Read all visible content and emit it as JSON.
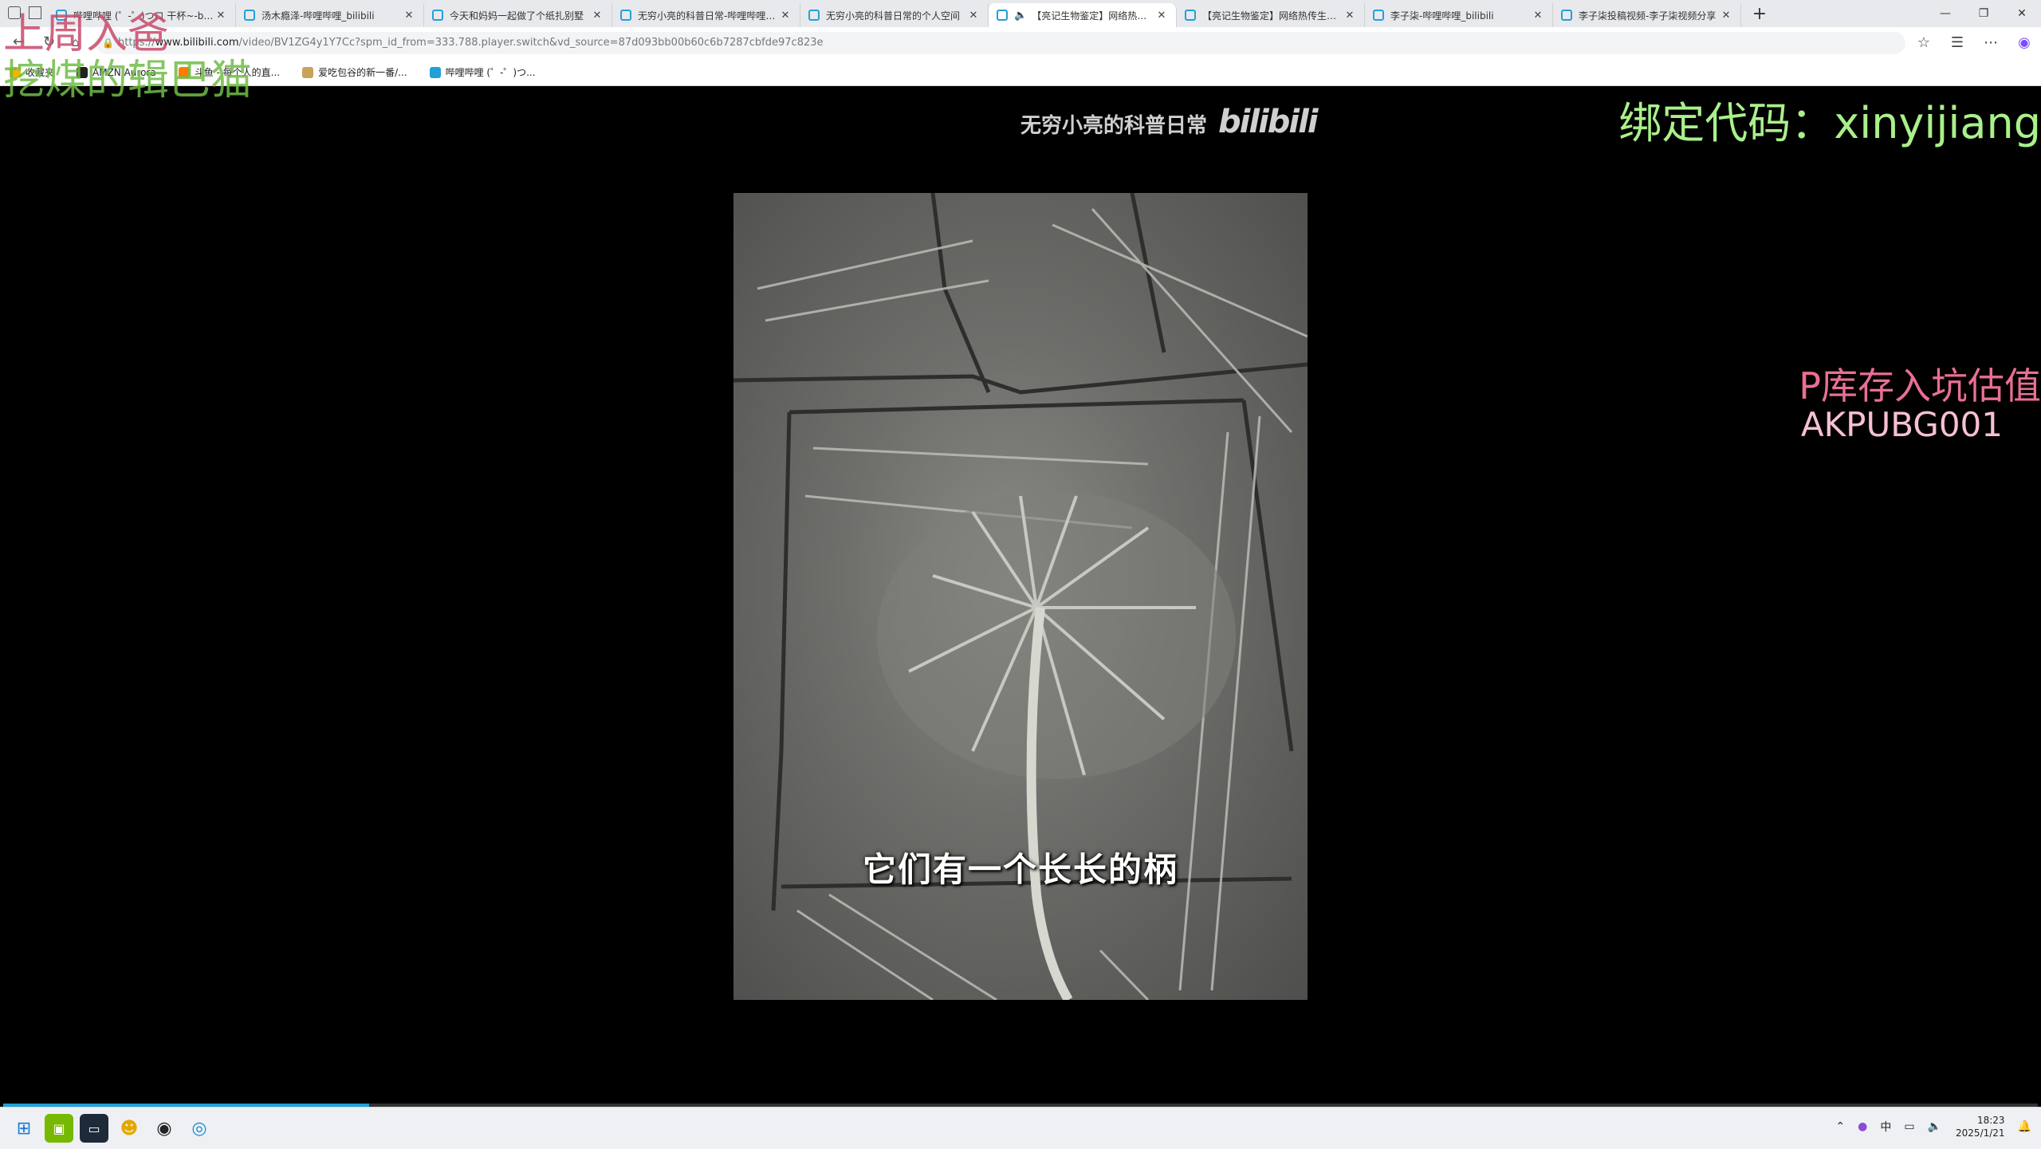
{
  "browser": {
    "tabs": [
      {
        "label": "哔哩哔哩 (゜-゜)つロ 干杯~-bilibili",
        "active": false
      },
      {
        "label": "汤木瘾泽-哔哩哔哩_bilibili",
        "active": false
      },
      {
        "label": "今天和妈妈一起做了个纸扎别墅",
        "active": false
      },
      {
        "label": "无穷小亮的科普日常-哔哩哔哩_bilibili",
        "active": false
      },
      {
        "label": "无穷小亮的科普日常的个人空间",
        "active": false
      },
      {
        "label": "【亮记生物鉴定】网络热传生物鉴定",
        "active": true
      },
      {
        "label": "【亮记生物鉴定】网络热传生物鉴定",
        "active": false
      },
      {
        "label": "李子柒-哔哩哔哩_bilibili",
        "active": false
      },
      {
        "label": "李子柒投稿视频-李子柒视频分享",
        "active": false
      }
    ],
    "url_prefix": "https://",
    "url_host": "www.bilibili.com",
    "url_path": "/video/BV1ZG4y1Y7Cc?spm_id_from=333.788.player.switch&vd_source=87d093bb00b60c6b7287cbfde97c823e",
    "bookmarks": [
      {
        "label": "收藏夹",
        "color": "#f5b400"
      },
      {
        "label": "AMZN Aurora",
        "color": "#222222"
      },
      {
        "label": "斗鱼 - 每个人的直...",
        "color": "#ff7a00"
      },
      {
        "label": "爱吃包谷的新一番/...",
        "color": "#c9a35a"
      },
      {
        "label": "哔哩哔哩 (゜-゜)つ...",
        "color": "#23a0d8"
      }
    ]
  },
  "video": {
    "watermark_text": "无穷小亮的科普日常",
    "watermark_logo": "bilibili",
    "subtitle": "它们有一个长长的柄",
    "progress_fraction": 0.18
  },
  "overlays": {
    "top_left_1": "上周入爸",
    "top_left_2": "挖煤的辑巴猫",
    "bind_code": "绑定代码：xinyijiang",
    "pk_text": "P库存入坑估值",
    "ak_code": "AKPUBG001"
  },
  "taskbar": {
    "time": "18:23",
    "date": "2025/1/21",
    "ime": "中"
  },
  "colors": {
    "accent": "#23a0d8",
    "bind_code": "#a9f08a",
    "pk_text": "#ea6f93"
  }
}
